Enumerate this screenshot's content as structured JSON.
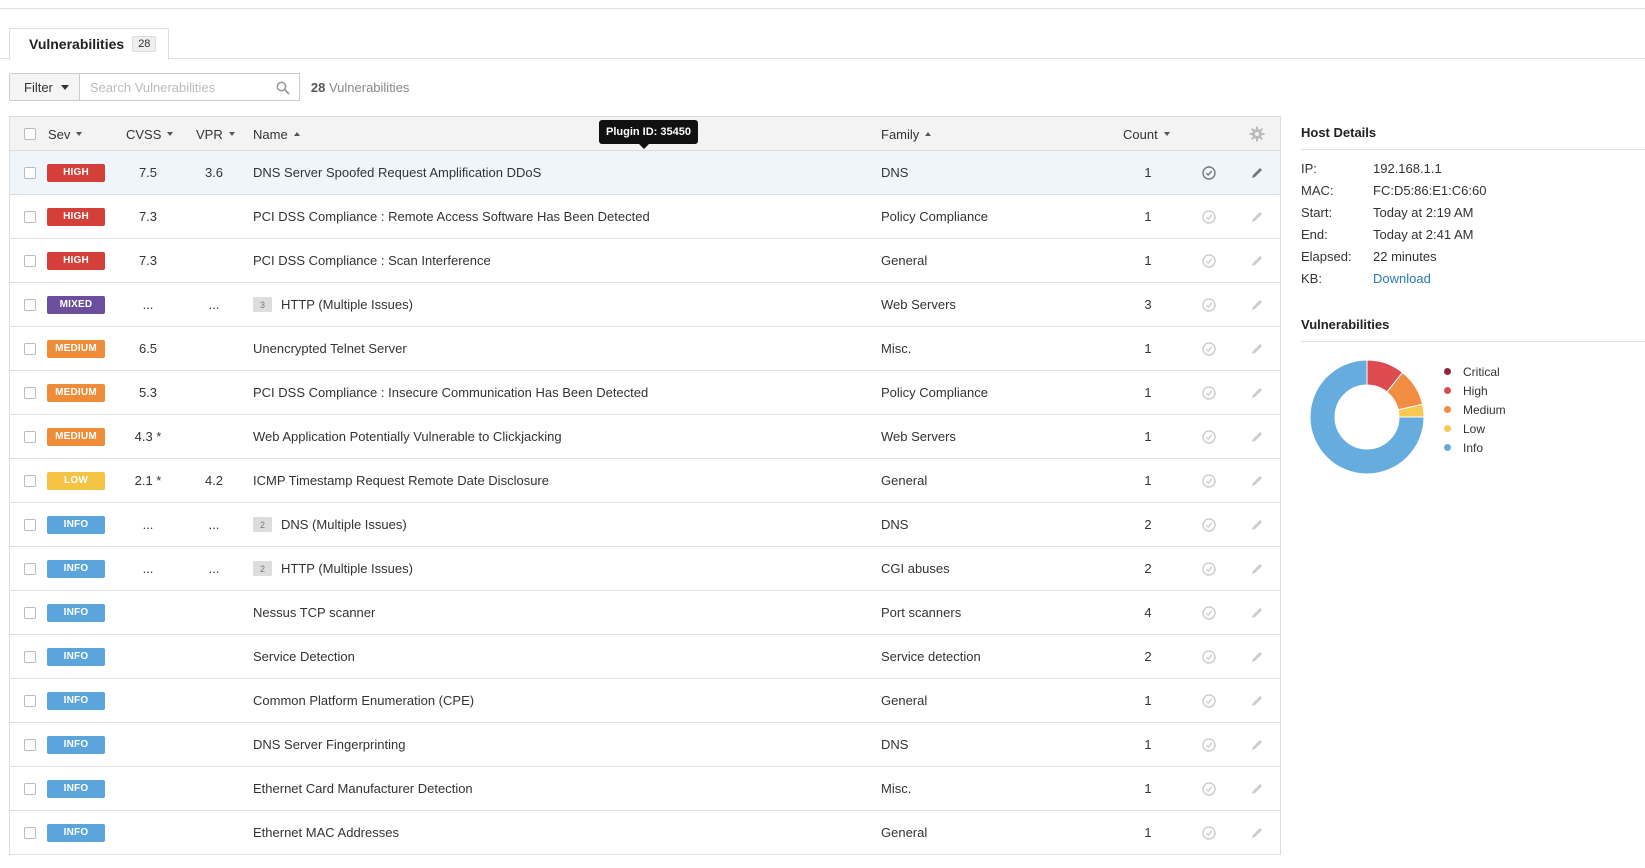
{
  "tab": {
    "label": "Vulnerabilities",
    "count": "28"
  },
  "toolbar": {
    "filter_label": "Filter",
    "search_placeholder": "Search Vulnerabilities",
    "count_num": "28",
    "count_text": " Vulnerabilities"
  },
  "table": {
    "headers": {
      "sev": "Sev",
      "cvss": "CVSS",
      "vpr": "VPR",
      "name": "Name",
      "family": "Family",
      "count": "Count"
    },
    "rows": [
      {
        "sev": "HIGH",
        "sev_color": "#d43f3a",
        "cvss": "7.5",
        "vpr": "3.6",
        "group": "",
        "name": "DNS Server Spoofed Request Amplification DDoS",
        "family": "DNS",
        "count": "1"
      },
      {
        "sev": "HIGH",
        "sev_color": "#d43f3a",
        "cvss": "7.3",
        "vpr": "",
        "group": "",
        "name": "PCI DSS Compliance : Remote Access Software Has Been Detected",
        "family": "Policy Compliance",
        "count": "1"
      },
      {
        "sev": "HIGH",
        "sev_color": "#d43f3a",
        "cvss": "7.3",
        "vpr": "",
        "group": "",
        "name": "PCI DSS Compliance : Scan Interference",
        "family": "General",
        "count": "1"
      },
      {
        "sev": "MIXED",
        "sev_color": "#6b4f9e",
        "cvss": "...",
        "vpr": "...",
        "group": "3",
        "name": "HTTP (Multiple Issues)",
        "family": "Web Servers",
        "count": "3"
      },
      {
        "sev": "MEDIUM",
        "sev_color": "#ee8c3a",
        "cvss": "6.5",
        "vpr": "",
        "group": "",
        "name": "Unencrypted Telnet Server",
        "family": "Misc.",
        "count": "1"
      },
      {
        "sev": "MEDIUM",
        "sev_color": "#ee8c3a",
        "cvss": "5.3",
        "vpr": "",
        "group": "",
        "name": "PCI DSS Compliance : Insecure Communication Has Been Detected",
        "family": "Policy Compliance",
        "count": "1"
      },
      {
        "sev": "MEDIUM",
        "sev_color": "#ee8c3a",
        "cvss": "4.3 *",
        "vpr": "",
        "group": "",
        "name": "Web Application Potentially Vulnerable to Clickjacking",
        "family": "Web Servers",
        "count": "1"
      },
      {
        "sev": "LOW",
        "sev_color": "#f5c342",
        "cvss": "2.1 *",
        "vpr": "4.2",
        "group": "",
        "name": "ICMP Timestamp Request Remote Date Disclosure",
        "family": "General",
        "count": "1"
      },
      {
        "sev": "INFO",
        "sev_color": "#5ba4dc",
        "cvss": "...",
        "vpr": "...",
        "group": "2",
        "name": "DNS (Multiple Issues)",
        "family": "DNS",
        "count": "2"
      },
      {
        "sev": "INFO",
        "sev_color": "#5ba4dc",
        "cvss": "...",
        "vpr": "...",
        "group": "2",
        "name": "HTTP (Multiple Issues)",
        "family": "CGI abuses",
        "count": "2"
      },
      {
        "sev": "INFO",
        "sev_color": "#5ba4dc",
        "cvss": "",
        "vpr": "",
        "group": "",
        "name": "Nessus TCP scanner",
        "family": "Port scanners",
        "count": "4"
      },
      {
        "sev": "INFO",
        "sev_color": "#5ba4dc",
        "cvss": "",
        "vpr": "",
        "group": "",
        "name": "Service Detection",
        "family": "Service detection",
        "count": "2"
      },
      {
        "sev": "INFO",
        "sev_color": "#5ba4dc",
        "cvss": "",
        "vpr": "",
        "group": "",
        "name": "Common Platform Enumeration (CPE)",
        "family": "General",
        "count": "1"
      },
      {
        "sev": "INFO",
        "sev_color": "#5ba4dc",
        "cvss": "",
        "vpr": "",
        "group": "",
        "name": "DNS Server Fingerprinting",
        "family": "DNS",
        "count": "1"
      },
      {
        "sev": "INFO",
        "sev_color": "#5ba4dc",
        "cvss": "",
        "vpr": "",
        "group": "",
        "name": "Ethernet Card Manufacturer Detection",
        "family": "Misc.",
        "count": "1"
      },
      {
        "sev": "INFO",
        "sev_color": "#5ba4dc",
        "cvss": "",
        "vpr": "",
        "group": "",
        "name": "Ethernet MAC Addresses",
        "family": "General",
        "count": "1"
      }
    ]
  },
  "tooltip": "Plugin ID: 35450",
  "host_details": {
    "title": "Host Details",
    "ip_label": "IP:",
    "ip": "192.168.1.1",
    "mac_label": "MAC:",
    "mac": "FC:D5:86:E1:C6:60",
    "start_label": "Start:",
    "start": "Today at 2:19 AM",
    "end_label": "End:",
    "end": "Today at 2:41 AM",
    "elapsed_label": "Elapsed:",
    "elapsed": "22 minutes",
    "kb_label": "KB:",
    "kb_link": "Download"
  },
  "vuln_chart": {
    "title": "Vulnerabilities",
    "legend": [
      {
        "label": "Critical",
        "color": "#91243e"
      },
      {
        "label": "High",
        "color": "#dd4b50"
      },
      {
        "label": "Medium",
        "color": "#f18c43"
      },
      {
        "label": "Low",
        "color": "#f8c851"
      },
      {
        "label": "Info",
        "color": "#67acdf"
      }
    ]
  },
  "chart_data": {
    "type": "pie",
    "title": "Vulnerabilities",
    "categories": [
      "Critical",
      "High",
      "Medium",
      "Low",
      "Info"
    ],
    "values": [
      0,
      3,
      3,
      1,
      21
    ]
  },
  "colors": {
    "link": "#2a7ab0",
    "selected_row": "#eef6fb"
  }
}
